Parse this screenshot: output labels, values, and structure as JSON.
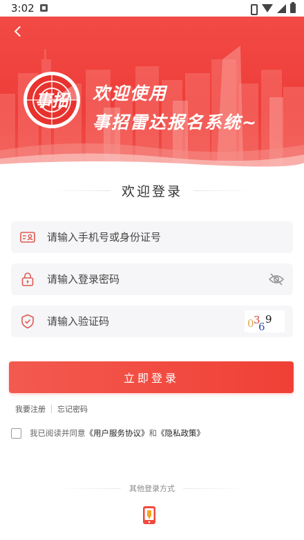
{
  "status_bar": {
    "time": "3:02"
  },
  "banner": {
    "logo_text": "事招",
    "line1": "欢迎使用",
    "line2": "事招雷达报名系统~",
    "colors": {
      "primary": "#ee3d39",
      "light": "#f6a09c"
    }
  },
  "form": {
    "title": "欢迎登录",
    "account_placeholder": "请输入手机号或身份证号",
    "password_placeholder": "请输入登录密码",
    "captcha_placeholder": "请输入验证码",
    "captcha_chars": [
      "0",
      "3",
      "6",
      "9"
    ],
    "login_label": "立即登录",
    "register_label": "我要注册",
    "forgot_label": "忘记密码",
    "agree_prefix": "我已阅读并同意",
    "agreement_link": "《用户服务协议》",
    "agree_and": "和",
    "privacy_link": "《隐私政策》",
    "agreed": false
  },
  "other_login": {
    "title": "其他登录方式",
    "method_icon": "phone-icon"
  },
  "colors": {
    "accent": "#f04036",
    "icon": "#e0584f",
    "field_bg": "#f6f6f8"
  }
}
